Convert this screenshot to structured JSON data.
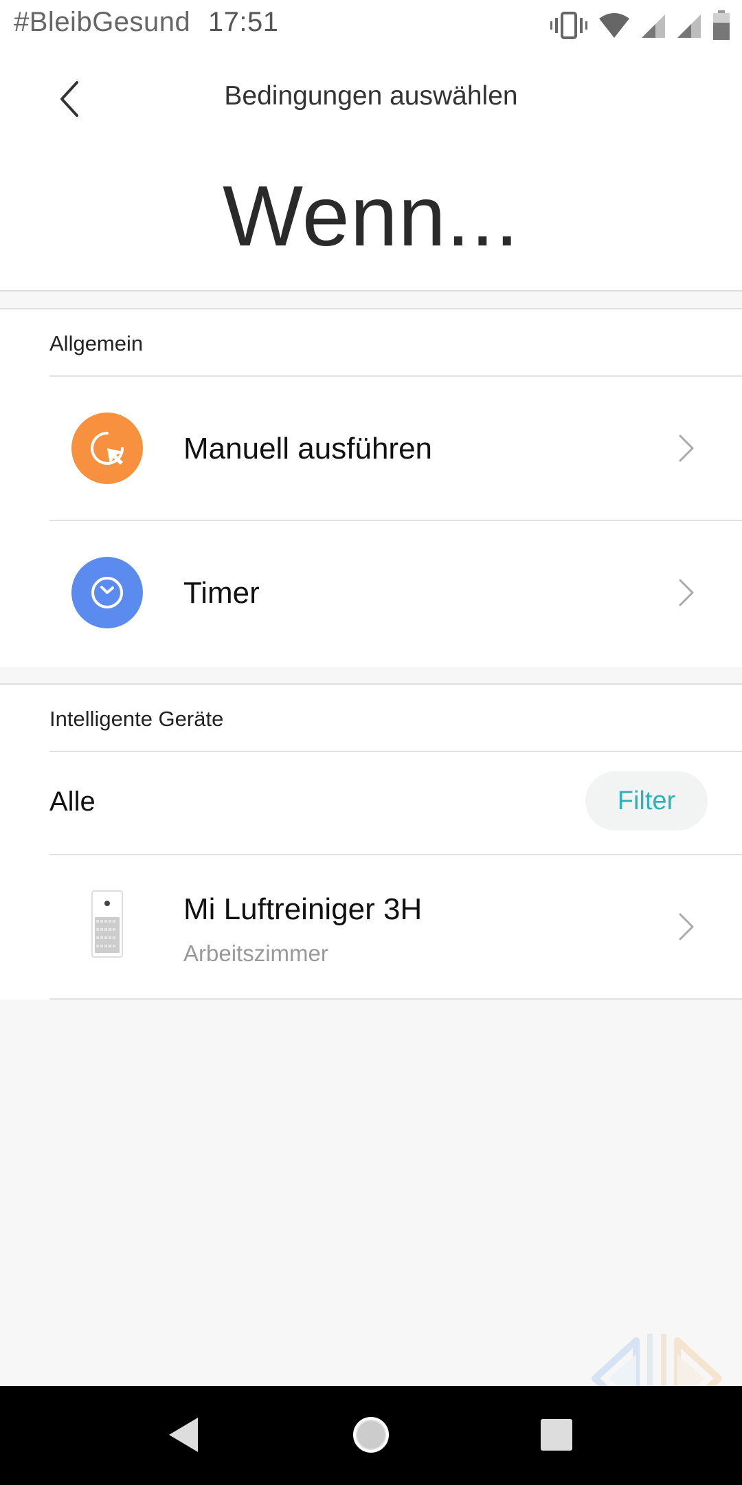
{
  "status_bar": {
    "carrier_text": "#BleibGesund",
    "time": "17:51",
    "icons": [
      "vibrate-icon",
      "wifi-icon",
      "signal-icon",
      "signal-icon",
      "battery-icon"
    ]
  },
  "header": {
    "title": "Bedingungen auswählen",
    "hero": "Wenn...",
    "back_icon": "chevron-left-icon"
  },
  "general": {
    "label": "Allgemein",
    "items": [
      {
        "label": "Manuell ausführen",
        "icon": "manual-tap-icon",
        "color": "#f7913f"
      },
      {
        "label": "Timer",
        "icon": "clock-icon",
        "color": "#5b8bee"
      }
    ]
  },
  "devices": {
    "label": "Intelligente Geräte",
    "filter_label": "Alle",
    "filter_button": "Filter",
    "items": [
      {
        "name": "Mi Luftreiniger 3H",
        "room": "Arbeitszimmer",
        "icon": "air-purifier-icon"
      }
    ]
  },
  "colors": {
    "accent": "#2bb3b8",
    "orange": "#f7913f",
    "blue": "#5b8bee"
  },
  "nav_bar": {
    "icons": [
      "back-triangle-icon",
      "home-circle-icon",
      "recents-square-icon"
    ]
  }
}
